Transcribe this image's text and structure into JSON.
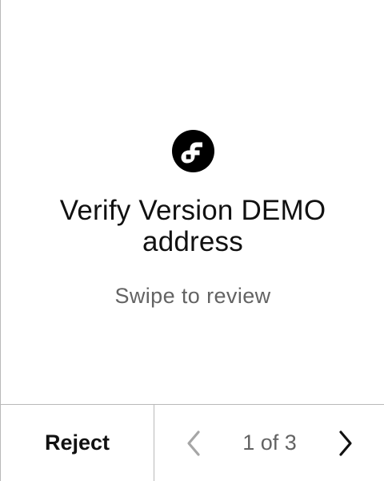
{
  "review": {
    "logo_icon": "flow-logo-icon",
    "title": "Verify Version DEMO address",
    "subtitle": "Swipe to review"
  },
  "footer": {
    "reject_label": "Reject",
    "page_indicator": "1 of 3",
    "prev_icon": "chevron-left-icon",
    "next_icon": "chevron-right-icon"
  },
  "colors": {
    "background": "#ffffff",
    "text_primary": "#111111",
    "text_secondary": "#636363",
    "divider": "#b9b9b9",
    "disabled_chevron": "#a6a6a6"
  }
}
